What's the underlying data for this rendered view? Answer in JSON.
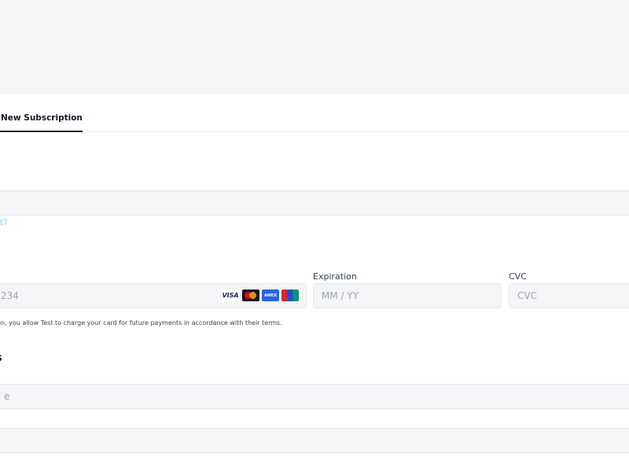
{
  "tabs": [
    {
      "label": "New Subscription",
      "active": true
    }
  ],
  "payment": {
    "email_field": {
      "value": "",
      "placeholder": ""
    },
    "link_text": "est?",
    "card_number": {
      "value": "",
      "placeholder": "234"
    },
    "card_brands": [
      "VISA",
      "mastercard-icon",
      "AMEX",
      "UnionPay"
    ],
    "expiration": {
      "label": "Expiration",
      "placeholder": "MM / YY"
    },
    "cvc": {
      "label": "CVC",
      "placeholder": "CVC"
    },
    "terms_text": "ormation, you allow Test to charge your card for future payments in accordance with their terms."
  },
  "address": {
    "title": "ss",
    "name_field": {
      "placeholder": "e"
    },
    "line_field": {
      "placeholder": ""
    }
  },
  "colors": {
    "panel_bg": "#f4f5f7",
    "field_border": "#e5e7eb",
    "link": "#93c5fd",
    "tab_underline": "#111827"
  }
}
